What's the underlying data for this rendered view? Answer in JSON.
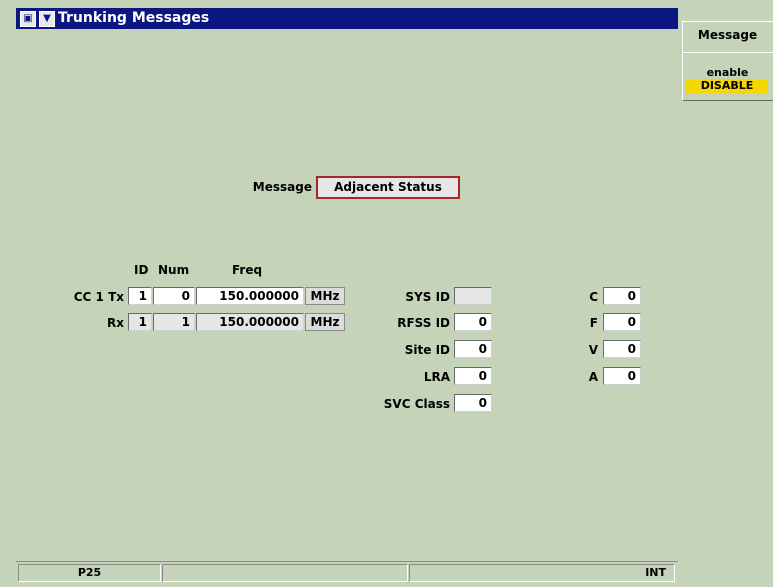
{
  "window": {
    "title": "Trunking Messages",
    "icon1": "restore-icon",
    "icon2": "menu-down-icon"
  },
  "message": {
    "label": "Message",
    "value": "Adjacent Status"
  },
  "cc_table": {
    "headers": {
      "id": "ID",
      "num": "Num",
      "freq": "Freq"
    },
    "tx": {
      "label": "CC 1 Tx",
      "id": "1",
      "num": "0",
      "freq": "150.000000",
      "unit": "MHz"
    },
    "rx": {
      "label": "Rx",
      "id": "1",
      "num": "1",
      "freq": "150.000000",
      "unit": "MHz"
    }
  },
  "system": {
    "sys_id": {
      "label": "SYS ID",
      "value": ""
    },
    "rfss_id": {
      "label": "RFSS ID",
      "value": "0"
    },
    "site_id": {
      "label": "Site ID",
      "value": "0"
    },
    "lra": {
      "label": "LRA",
      "value": "0"
    },
    "svc_class": {
      "label": "SVC Class",
      "value": "0"
    }
  },
  "flags": {
    "c": {
      "label": "C",
      "value": "0"
    },
    "f": {
      "label": "F",
      "value": "0"
    },
    "v": {
      "label": "V",
      "value": "0"
    },
    "a": {
      "label": "A",
      "value": "0"
    }
  },
  "side_menu": {
    "title": "Message",
    "label": "enable",
    "value": "DISABLE"
  },
  "status_bar": {
    "left": "P25",
    "middle": "",
    "right_middle": "",
    "right": "INT"
  },
  "colors": {
    "background": "#c5d4b8",
    "titlebar": "#0c1680",
    "highlight": "#f5d800",
    "focus_border": "#a52727"
  }
}
